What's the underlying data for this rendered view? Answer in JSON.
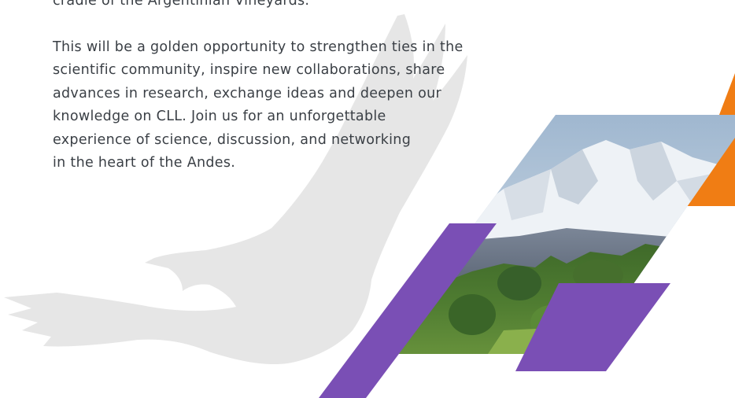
{
  "content": {
    "intro_tail": "cradle of the Argentinian Vineyards.",
    "paragraph_lines": [
      "This will be a golden opportunity to strengthen ties in the",
      "scientific community, inspire new collaborations, share",
      "advances in research, exchange ideas and deepen our",
      "knowledge on CLL. Join us for an unforgettable",
      "experience of science, discussion, and networking",
      "in the heart of the Andes."
    ]
  },
  "decor": {
    "eagle_icon": "eagle-silhouette",
    "photo": "andes-mountains-vineyard",
    "colors": {
      "text": "#3a3f45",
      "eagle": "#e6e6e6",
      "purple": "#7a4fb5",
      "orange": "#f07d14"
    }
  }
}
